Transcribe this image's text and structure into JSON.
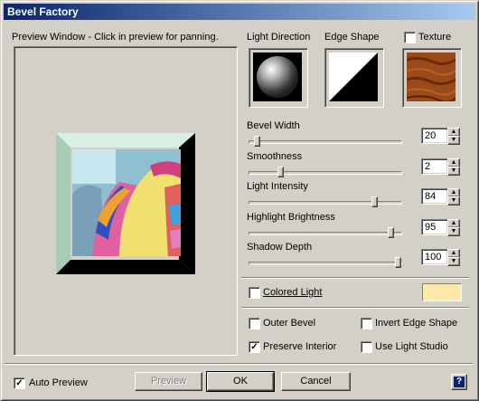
{
  "window": {
    "title": "Bevel Factory"
  },
  "preview": {
    "label": "Preview Window - Click in preview for panning."
  },
  "headers": {
    "light_direction": "Light Direction",
    "edge_shape": "Edge Shape",
    "texture": "Texture"
  },
  "texture_checked": false,
  "sliders": [
    {
      "label": "Bevel Width",
      "value": "20",
      "fraction": 0.04
    },
    {
      "label": "Smoothness",
      "value": "2",
      "fraction": 0.2
    },
    {
      "label": "Light Intensity",
      "value": "84",
      "fraction": 0.84
    },
    {
      "label": "Highlight Brightness",
      "value": "95",
      "fraction": 0.95
    },
    {
      "label": "Shadow Depth",
      "value": "100",
      "fraction": 1.0
    }
  ],
  "colored_light": {
    "label": "Colored Light",
    "checked": false,
    "swatch_color": "#ffe8a8"
  },
  "options": {
    "outer_bevel": {
      "label": "Outer Bevel",
      "checked": false
    },
    "invert_edge_shape": {
      "label": "Invert Edge Shape",
      "checked": false
    },
    "preserve_interior": {
      "label": "Preserve Interior",
      "checked": true
    },
    "use_light_studio": {
      "label": "Use Light Studio",
      "checked": false
    }
  },
  "footer": {
    "auto_preview": {
      "label": "Auto Preview",
      "checked": true
    },
    "preview_button": "Preview",
    "ok_button": "OK",
    "cancel_button": "Cancel",
    "help_icon": "?"
  },
  "colors": {
    "title_start": "#0a246a",
    "title_end": "#a6caf0",
    "face": "#d4d0c8"
  }
}
